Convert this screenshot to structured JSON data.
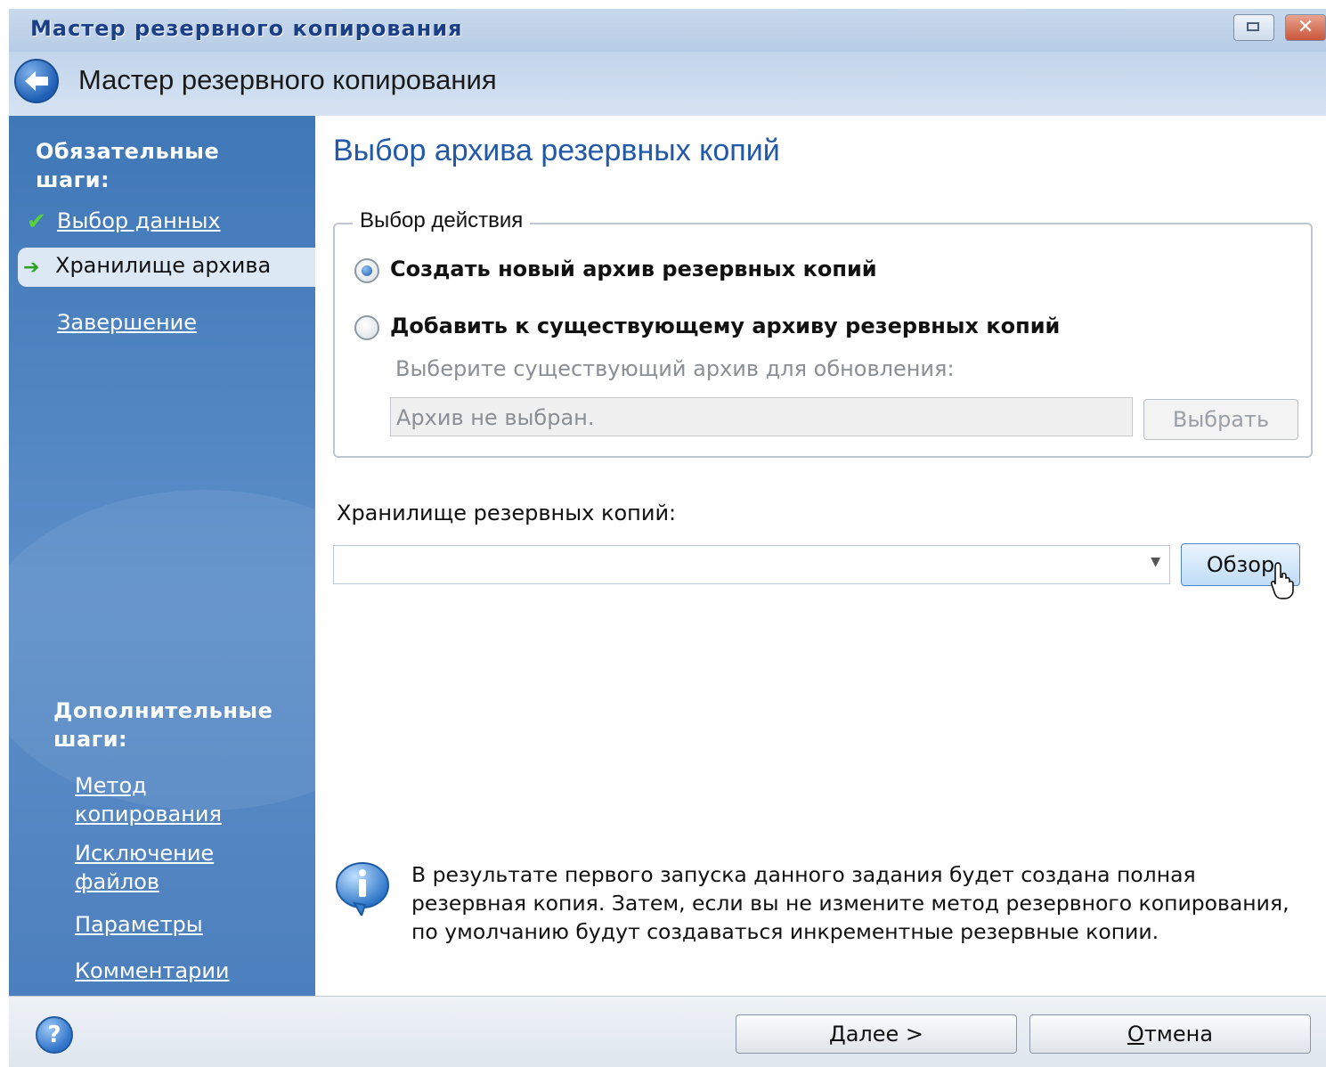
{
  "window": {
    "title": "Мастер резервного копирования",
    "header_title": "Мастер резервного копирования"
  },
  "sidebar": {
    "required_heading": "Обязательные шаги:",
    "required_steps": [
      {
        "label": "Выбор данных",
        "state": "done"
      },
      {
        "label": "Хранилище архива",
        "state": "current"
      },
      {
        "label": "Завершение",
        "state": "pending"
      }
    ],
    "optional_heading": "Дополнительные шаги:",
    "optional_steps": [
      {
        "label": "Метод копирования"
      },
      {
        "label": "Исключение файлов"
      },
      {
        "label": "Параметры"
      },
      {
        "label": "Комментарии"
      }
    ]
  },
  "content": {
    "title": "Выбор архива резервных копий",
    "action_group": {
      "legend": "Выбор действия",
      "option_new": "Создать новый архив резервных копий",
      "option_existing": "Добавить к существующему архиву резервных копий",
      "selected": "new",
      "existing_hint": "Выберите существующий архив для обновления:",
      "existing_value": "Архив не выбран.",
      "choose_button": "Выбрать"
    },
    "storage": {
      "label": "Хранилище резервных копий:",
      "value": "",
      "browse_button": "Обзор"
    },
    "info_text": "В результате первого запуска данного задания будет создана полная резервная копия. Затем, если вы не измените метод резервного копирования, по умолчанию будут создаваться инкрементные резервные копии."
  },
  "footer": {
    "next_button_accel": "Д",
    "next_button_rest": "алее >",
    "cancel_button_accel": "О",
    "cancel_button_rest": "тмена"
  },
  "colors": {
    "sidebar": "#4c7fbd",
    "title_accent": "#2159a8",
    "titlebar_text": "#1b3f86"
  }
}
